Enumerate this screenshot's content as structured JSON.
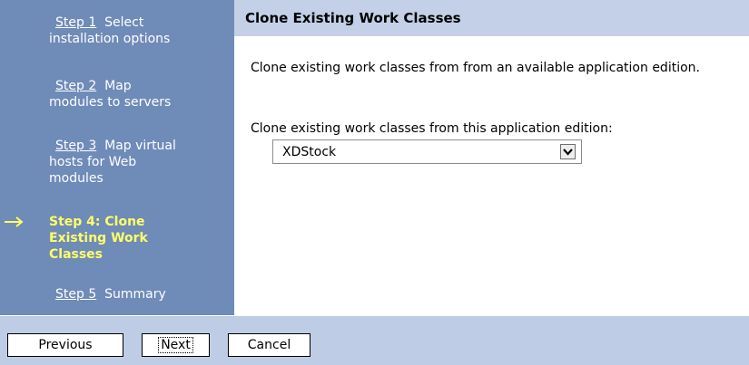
{
  "steps": [
    {
      "link": "Step 1",
      "rest_line1": "Select",
      "rest_more": "installation options",
      "active": false
    },
    {
      "link": "Step 2",
      "rest_line1": "Map",
      "rest_more": "modules to servers",
      "active": false
    },
    {
      "link": "Step 3",
      "rest_line1": "Map virtual",
      "rest_more": "hosts for Web modules",
      "active": false
    },
    {
      "text": "Step 4: Clone Existing Work Classes",
      "active": true
    },
    {
      "link": "Step 5",
      "rest_line1": "Summary",
      "active": false
    }
  ],
  "content": {
    "title": "Clone Existing Work Classes",
    "description": "Clone existing work classes from from an available application edition.",
    "field_label": "Clone existing work classes from this application edition:",
    "select_value": "XDStock"
  },
  "buttons": {
    "previous": "Previous",
    "next": "Next",
    "cancel": "Cancel"
  },
  "icons": {
    "current_step": "right-arrow-icon",
    "dropdown": "chevron-down-icon"
  },
  "colors": {
    "sidebar_bg": "#6f8bb8",
    "title_bar_bg": "#c4d0e8",
    "footer_bg": "#bfcce6",
    "active_step": "#ffff66"
  }
}
